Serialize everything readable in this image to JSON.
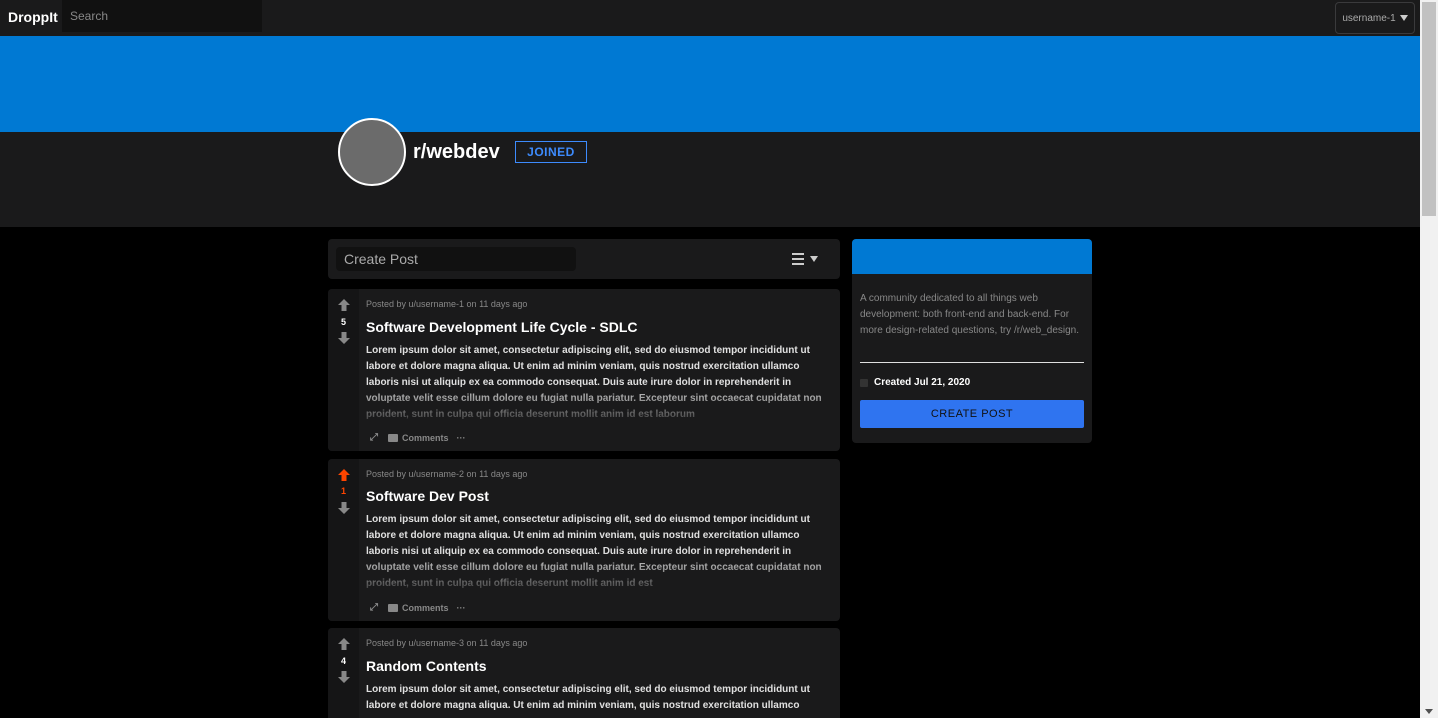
{
  "header": {
    "brand": "DroppIt",
    "search_placeholder": "Search",
    "username": "username-1"
  },
  "subreddit": {
    "name": "r/webdev",
    "joined_label": "JOINED",
    "banner_color": "#0079d3"
  },
  "create_post_bar": {
    "placeholder": "Create Post"
  },
  "posts": [
    {
      "meta": "Posted by u/username-1 on 11 days ago",
      "score": "5",
      "vote_state": "none",
      "title": "Software Development Life Cycle - SDLC",
      "body": "Lorem ipsum dolor sit amet, consectetur adipiscing elit, sed do eiusmod tempor incididunt ut labore et dolore magna aliqua. Ut enim ad minim veniam, quis nostrud exercitation ullamco laboris nisi ut aliquip ex ea commodo consequat. Duis aute irure dolor in reprehenderit in voluptate velit esse cillum dolore eu fugiat nulla pariatur. Excepteur sint occaecat cupidatat non proident, sunt in culpa qui officia deserunt mollit anim id est laborum",
      "comments_label": "Comments"
    },
    {
      "meta": "Posted by u/username-2 on 11 days ago",
      "score": "1",
      "vote_state": "upvoted",
      "title": "Software Dev Post",
      "body": "Lorem ipsum dolor sit amet, consectetur adipiscing elit, sed do eiusmod tempor incididunt ut labore et dolore magna aliqua. Ut enim ad minim veniam, quis nostrud exercitation ullamco laboris nisi ut aliquip ex ea commodo consequat. Duis aute irure dolor in reprehenderit in voluptate velit esse cillum dolore eu fugiat nulla pariatur. Excepteur sint occaecat cupidatat non proident, sunt in culpa qui officia deserunt mollit anim id est",
      "comments_label": "Comments"
    },
    {
      "meta": "Posted by u/username-3 on 11 days ago",
      "score": "4",
      "vote_state": "none",
      "title": "Random Contents",
      "body": "Lorem ipsum dolor sit amet, consectetur adipiscing elit, sed do eiusmod tempor incididunt ut labore et dolore magna aliqua. Ut enim ad minim veniam, quis nostrud exercitation ullamco",
      "comments_label": "Comments"
    }
  ],
  "sidebar": {
    "description": "A community dedicated to all things web development: both front-end and back-end. For more design-related questions, try /r/web_design.",
    "created": "Created Jul 21, 2020",
    "create_post_label": "CREATE POST",
    "accent_color": "#2f74f0"
  },
  "colors": {
    "upvote_active": "#ff4500",
    "vote_default": "#888888"
  }
}
